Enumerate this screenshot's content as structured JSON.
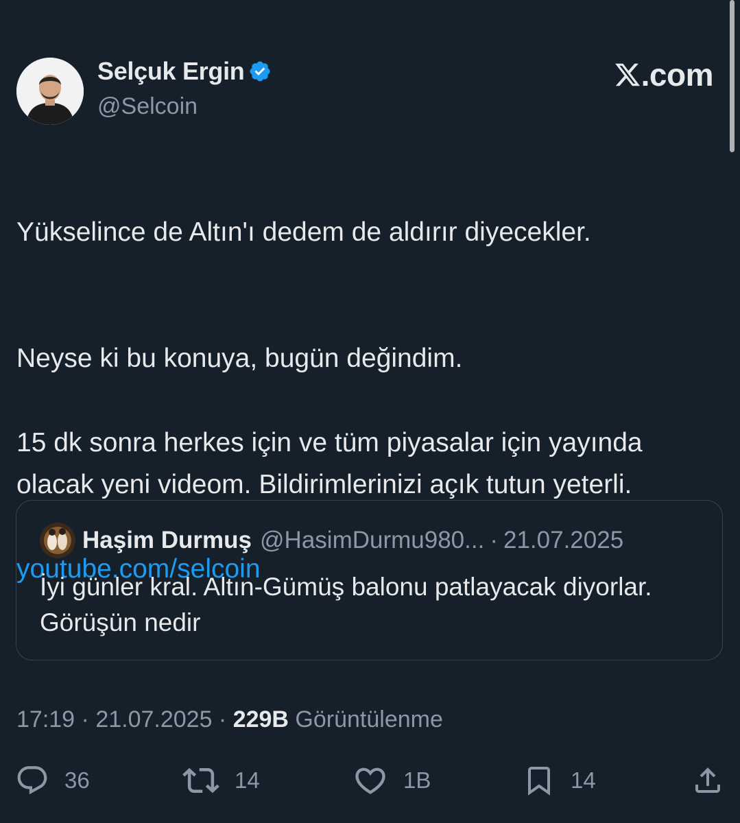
{
  "author": {
    "display_name": "Selçuk Ergin",
    "handle": "@Selcoin",
    "verified_icon": "verified-badge-icon"
  },
  "brand": {
    "logo_icon": "x-logo-icon",
    "text": ".com"
  },
  "tweet": {
    "paragraph_1": "Yükselince de Altın'ı dedem de aldırır diyecekler.",
    "paragraph_2_line_1": "Neyse ki bu konuya, bugün değindim.",
    "paragraph_2_line_2": "15 dk sonra herkes için ve tüm piyasalar için yayında olacak yeni videom. Bildirimlerinizi açık tutun yeterli.",
    "link": "youtube.com/selcoin"
  },
  "quote": {
    "display_name": "Haşim Durmuş",
    "handle": "@HasimDurmu980...",
    "separator": "·",
    "date": "21.07.2025",
    "text": "İyi günler kral. Altın-Gümüş balonu patlayacak diyorlar. Görüşün nedir"
  },
  "meta": {
    "time": "17:19",
    "sep1": " · ",
    "date": "21.07.2025",
    "sep2": " · ",
    "views": "229B",
    "views_label": " Görüntülenme"
  },
  "actions": {
    "reply_count": "36",
    "retweet_count": "14",
    "like_count": "1B",
    "bookmark_count": "14"
  },
  "colors": {
    "background": "#15202b",
    "text": "#e7e9ea",
    "secondary": "#8b98a5",
    "link": "#1d9bf0",
    "border": "#38444d"
  }
}
